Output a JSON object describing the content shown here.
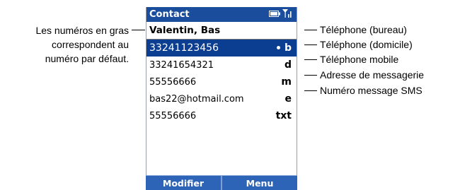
{
  "titlebar": {
    "title": "Contact",
    "battery_icon": "battery-icon",
    "signal_icon": "signal-icon"
  },
  "contact": {
    "name": "Valentin, Bas",
    "entries": [
      {
        "value": "33241123456",
        "code": "b",
        "selected": true,
        "default_marker": "•"
      },
      {
        "value": "33241654321",
        "code": "d",
        "selected": false
      },
      {
        "value": "55556666",
        "code": "m",
        "selected": false
      },
      {
        "value": "bas22@hotmail.com",
        "code": "e",
        "selected": false
      },
      {
        "value": "55556666",
        "code": "txt",
        "selected": false
      }
    ]
  },
  "softkeys": {
    "left": "Modifier",
    "right": "Menu"
  },
  "annotations": {
    "left_note": [
      "Les numéros en gras",
      "correspondent au",
      "numéro par défaut."
    ],
    "right": [
      "Téléphone (bureau)",
      "Téléphone (domicile)",
      "Téléphone mobile",
      "Adresse de messagerie",
      "Numéro message SMS"
    ]
  },
  "colors": {
    "titlebar": "#1a4d9c",
    "selected_row": "#0b3d91",
    "softbar": "#2e64b8"
  }
}
